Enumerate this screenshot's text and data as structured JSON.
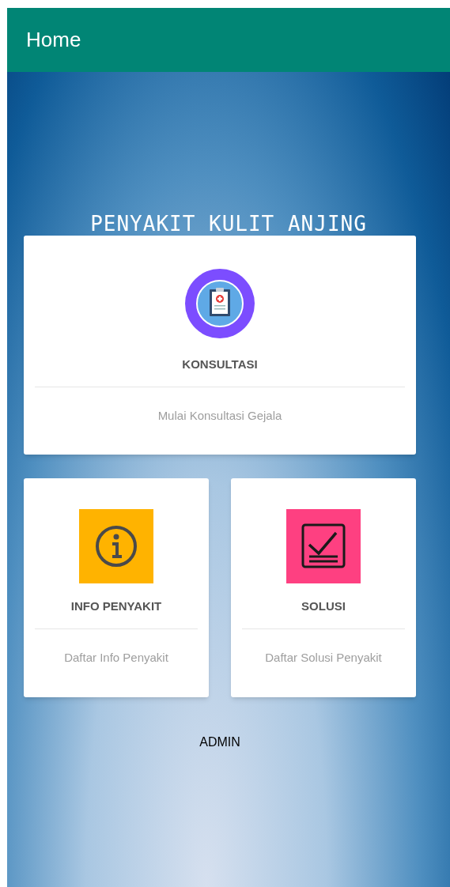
{
  "app_bar": {
    "title": "Home"
  },
  "heading": "PENYAKIT KULIT ANJING",
  "menu_cards": [
    {
      "kind": "clipboard",
      "title": "KONSULTASI",
      "subtitle": "Mulai Konsultasi Gejala"
    },
    {
      "kind": "info",
      "title": "INFO PENYAKIT",
      "subtitle": "Daftar Info Penyakit"
    },
    {
      "kind": "checklist",
      "title": "SOLUSI",
      "subtitle": "Daftar Solusi Penyakit"
    }
  ],
  "admin_link": "ADMIN"
}
